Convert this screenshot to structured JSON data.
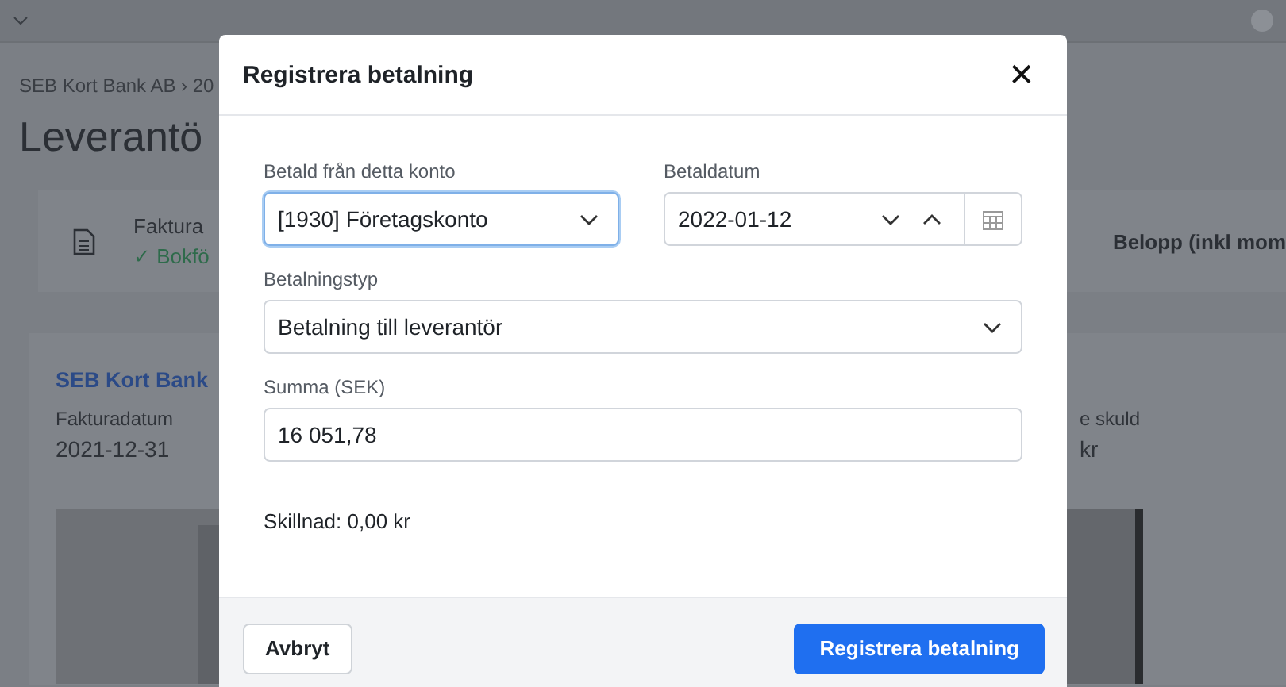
{
  "background": {
    "breadcrumb": "SEB Kort Bank AB › 20",
    "title": "Leverantö",
    "status_card": {
      "label": "Faktura",
      "status": "✓ Bokfö",
      "amount_heading": "Belopp (inkl mom"
    },
    "invoice_card": {
      "supplier": "SEB Kort Bank",
      "date_label": "Fakturadatum",
      "date": "2021-12-31",
      "debt_label": "e skuld",
      "debt": "kr"
    }
  },
  "modal": {
    "title": "Registrera betalning",
    "close": "✕",
    "fields": [
      {
        "kind": "select",
        "label": "Betald från detta konto",
        "value": "[1930] Företagskonto",
        "focused": true
      },
      {
        "kind": "date",
        "label": "Betaldatum",
        "value": "2022-01-12",
        "focused": false
      },
      {
        "kind": "select",
        "label": "Betalningstyp",
        "value": "Betalning till leverantör",
        "focused": false
      },
      {
        "kind": "text",
        "label": "Summa (SEK)",
        "value": "16 051,78",
        "focused": false
      }
    ],
    "difference": "Skillnad: 0,00 kr",
    "buttons": [
      {
        "kind": "secondary",
        "label": "Avbryt"
      },
      {
        "kind": "primary",
        "label": "Registrera betalning"
      }
    ]
  }
}
